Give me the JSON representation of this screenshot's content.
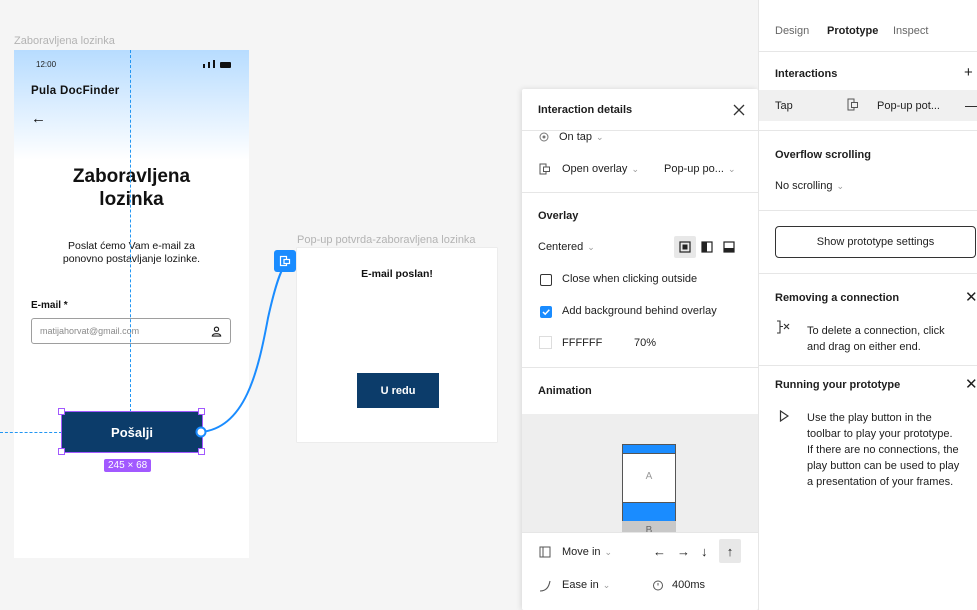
{
  "canvas": {
    "phone_frame_label": "Zaboravljena lozinka",
    "popup_frame_label": "Pop-up potvrda-zaboravljena lozinka",
    "phone": {
      "status_time": "12:00",
      "brand": "Pula DocFinder",
      "back_icon": "arrow-left-icon",
      "title_line1": "Zaboravljena",
      "title_line2": "lozinka",
      "desc_line1": "Poslat ćemo Vam e-mail za",
      "desc_line2": "ponovno postavljanje lozinke.",
      "email_label": "E-mail *",
      "email_value": "matijahorvat@gmail.com",
      "send_button": "Pošalji",
      "size_badge": "245 × 68"
    },
    "popup": {
      "message": "E-mail poslan!",
      "ok_button": "U redu"
    }
  },
  "details": {
    "title": "Interaction details",
    "trigger": "On tap",
    "action": "Open overlay",
    "destination": "Pop-up po...",
    "overlay_heading": "Overlay",
    "position": "Centered",
    "close_outside": "Close when clicking outside",
    "close_outside_checked": false,
    "add_background": "Add background behind overlay",
    "add_background_checked": true,
    "bg_color": "FFFFFF",
    "bg_opacity": "70%",
    "animation_heading": "Animation",
    "preview_a": "A",
    "preview_b": "B",
    "animation_type": "Move in",
    "easing": "Ease in",
    "duration": "400ms"
  },
  "right_panel": {
    "tabs": [
      "Design",
      "Prototype",
      "Inspect"
    ],
    "active_tab": "Prototype",
    "interactions_heading": "Interactions",
    "interaction_trigger": "Tap",
    "interaction_target": "Pop-up pot...",
    "overflow_heading": "Overflow scrolling",
    "overflow_value": "No scrolling",
    "settings_button": "Show prototype settings",
    "removing_heading": "Removing a connection",
    "removing_line1": "To delete a connection, click",
    "removing_line2": "and drag on either end.",
    "running_heading": "Running your prototype",
    "running_lines": [
      "Use the play button in the",
      "toolbar to play your prototype.",
      "If there are no connections, the",
      "play button can be used to play",
      "a presentation of your frames."
    ]
  },
  "colors": {
    "accent": "#1a8cff",
    "selection": "#a259ff",
    "button_navy": "#0c3c6a"
  }
}
